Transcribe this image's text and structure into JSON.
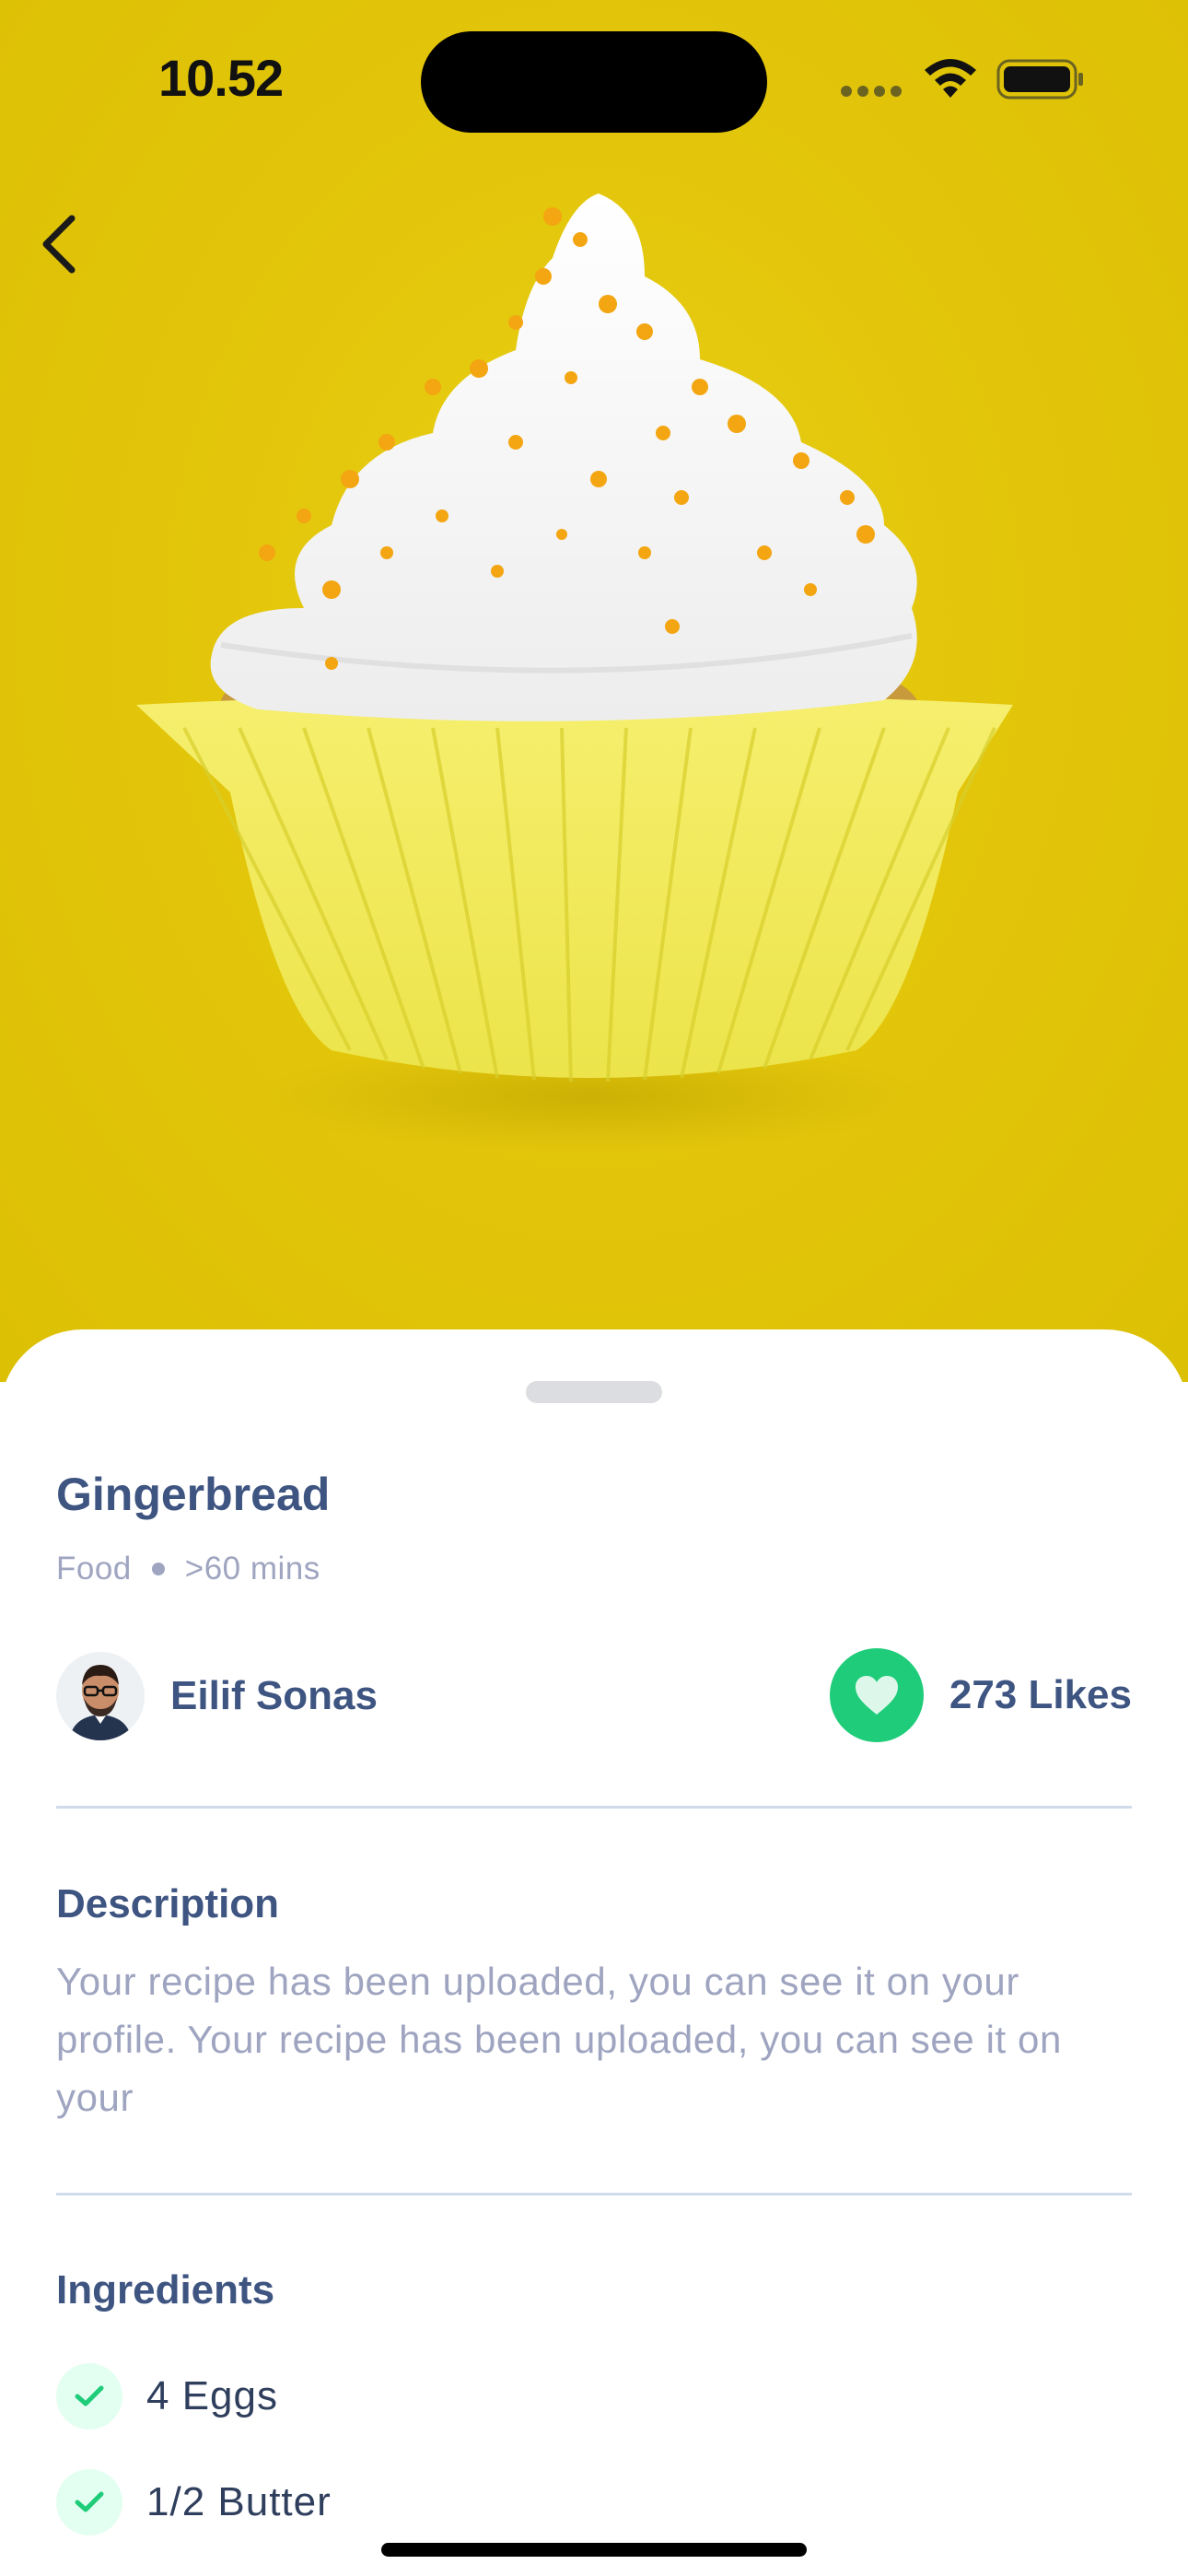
{
  "status_bar": {
    "time": "10.52"
  },
  "nav": {
    "back_icon": "chevron-left-icon"
  },
  "hero": {
    "image": "cupcake-photo",
    "background_color": "#e3c60b"
  },
  "recipe": {
    "title": "Gingerbread",
    "category": "Food",
    "duration": ">60 mins",
    "author": {
      "name": "Eilif Sonas",
      "avatar": "avatar"
    },
    "likes": {
      "label": "273 Likes",
      "icon": "heart-icon",
      "color": "#1fcc79"
    }
  },
  "description": {
    "heading": "Description",
    "text": "Your recipe has been uploaded, you can see it on your profile. Your recipe has been uploaded, you can see it on your"
  },
  "ingredients": {
    "heading": "Ingredients",
    "items": [
      {
        "label": "4 Eggs"
      },
      {
        "label": "1/2 Butter"
      }
    ]
  },
  "colors": {
    "primary_text": "#3e5481",
    "secondary_text": "#9fa5c0",
    "accent": "#1fcc79"
  }
}
